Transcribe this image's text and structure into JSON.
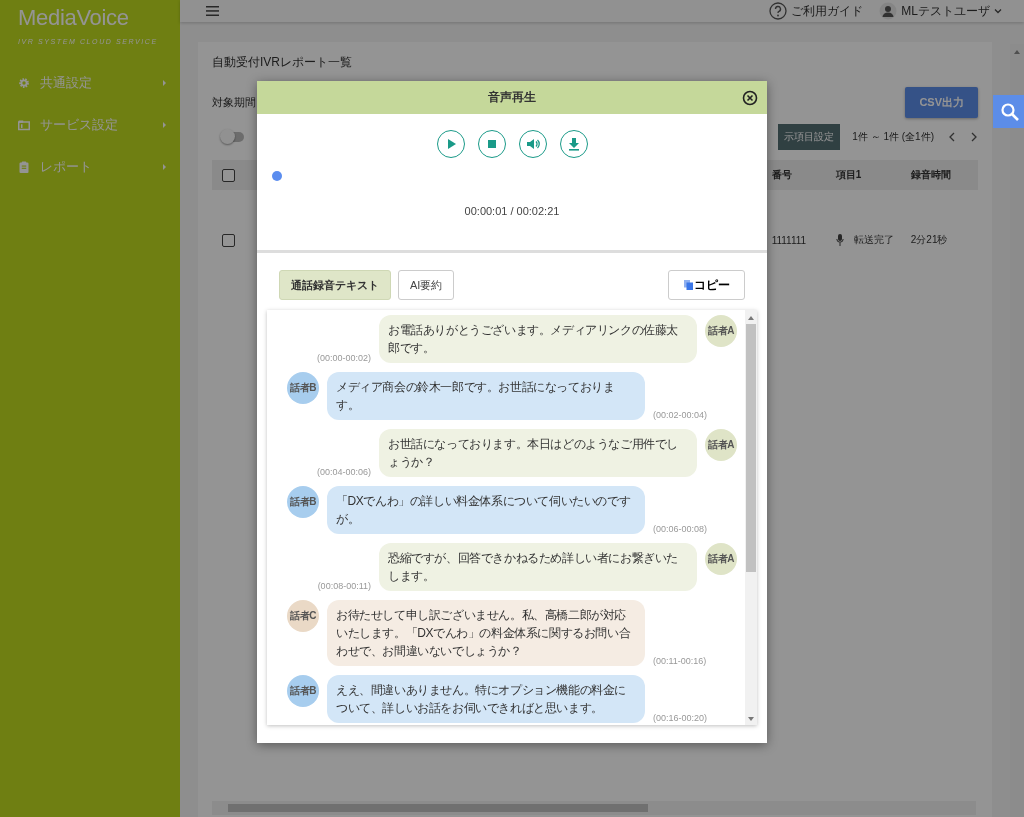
{
  "sidebar": {
    "logo": "**Media**Voice",
    "tagline": "IVR SYSTEM CLOUD SERVICE",
    "items": [
      {
        "label": "共通設定",
        "expanded": false
      },
      {
        "label": "サービス設定",
        "expanded": false
      },
      {
        "label": "レポート",
        "expanded": false
      }
    ]
  },
  "top_bar": {
    "help": "ご利用ガイド",
    "user": "MLテストユーザ"
  },
  "page": {
    "title": "自動受付IVRレポート一覧",
    "period_label": "対象期間",
    "csv_button": "CSV出力",
    "toggle": {
      "on": false
    },
    "columns_button": "示項目設定",
    "paging": "1件 ～ 1件 (全1件)",
    "table": {
      "columns": [
        "番号",
        "項目1",
        "録音時間"
      ],
      "rows": [
        {
          "checked": false,
          "cells": [
            "1111111",
            "転送完了",
            "2分21秒"
          ]
        }
      ],
      "header_checked": false
    }
  },
  "dialog": {
    "title": "音声再生",
    "seek": {
      "level": 0.007
    },
    "time": "00:00:01 / 00:02:21",
    "tabs": [
      {
        "label": "通話録音テキスト",
        "selected": true
      },
      {
        "label": "AI要約",
        "selected": false
      }
    ],
    "copy_button": "コピー",
    "messages": [
      {
        "kind": "outgoing",
        "speaker": "話者A",
        "color": "#dfe4c7",
        "text": "お電話ありがとうございます。メディアリンクの佐藤太郎です。",
        "time": "(00:00-00:02)"
      },
      {
        "kind": "incoming",
        "speaker": "話者B",
        "color": "#a7cdee",
        "text": "メディア商会の鈴木一郎です。お世話になっております。",
        "time": "(00:02-00:04)"
      },
      {
        "kind": "outgoing",
        "speaker": "話者A",
        "color": "#dfe4c7",
        "text": "お世話になっております。本日はどのようなご用件でしょうか？",
        "time": "(00:04-00:06)"
      },
      {
        "kind": "incoming",
        "speaker": "話者B",
        "color": "#a7cdee",
        "text": "「DXでんわ」の詳しい料金体系について伺いたいのですが。",
        "time": "(00:06-00:08)"
      },
      {
        "kind": "outgoing",
        "speaker": "話者A",
        "color": "#dfe4c7",
        "text": "恐縮ですが、回答できかねるため詳しい者にお繋ぎいたします。",
        "time": "(00:08-00:11)"
      },
      {
        "kind": "incoming",
        "speaker": "話者C",
        "color": "#ead9c6",
        "text": "お待たせして申し訳ございません。私、高橋二郎が対応いたします。「DXでんわ」の料金体系に関するお問い合わせで、お間違いないでしょうか？",
        "time": "(00:11-00:16)"
      },
      {
        "kind": "incoming",
        "speaker": "話者B",
        "color": "#a7cdee",
        "text": "ええ、間違いありません。特にオプション機能の料金について、詳しいお話をお伺いできればと思います。",
        "time": "(00:16-00:20)"
      }
    ]
  }
}
